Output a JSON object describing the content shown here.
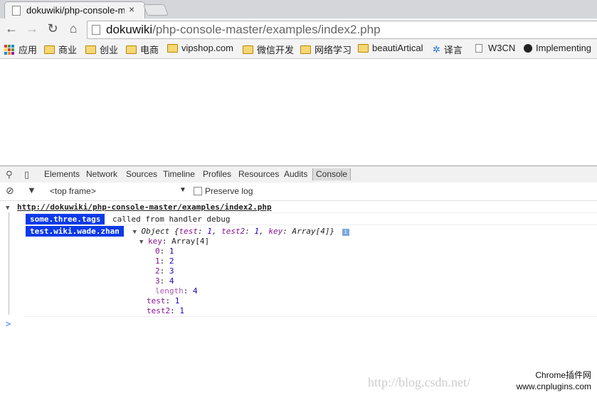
{
  "tab": {
    "title": "dokuwiki/php-console-m",
    "close": "×"
  },
  "omnibox": {
    "host": "dokuwiki",
    "path": "/php-console-master/examples/index2.php"
  },
  "nav": {
    "back": "←",
    "forward": "→",
    "reload": "↻",
    "home": "⌂"
  },
  "bookmarks": [
    {
      "label": "应用",
      "icon": "apps-icon"
    },
    {
      "label": "商业",
      "icon": "folder-icon"
    },
    {
      "label": "创业",
      "icon": "folder-icon"
    },
    {
      "label": "电商",
      "icon": "folder-icon"
    },
    {
      "label": "vipshop.com",
      "icon": "folder-icon"
    },
    {
      "label": "微信开发",
      "icon": "folder-icon"
    },
    {
      "label": "网络学习",
      "icon": "folder-icon"
    },
    {
      "label": "beautiArtical",
      "icon": "folder-icon"
    },
    {
      "label": "译言",
      "icon": "translate-icon"
    },
    {
      "label": "W3CN",
      "icon": "page-icon"
    },
    {
      "label": "Implementing",
      "icon": "site-icon"
    }
  ],
  "devtools": {
    "tabs": [
      "Elements",
      "Network",
      "Sources",
      "Timeline",
      "Profiles",
      "Resources",
      "Audits",
      "Console"
    ],
    "active_tab": "Console",
    "frame": "<top frame>",
    "preserve_log": "Preserve log"
  },
  "console": {
    "group_url": "http://dokuwiki/php-console-master/examples/index2.php",
    "row1": {
      "tag": "some.three.tags",
      "text": "called from handler debug"
    },
    "row2": {
      "tag": "test.wiki.wade.zhan",
      "obj_prefix": "Object {",
      "k1": "test",
      "v1": "1",
      "k2": "test2",
      "v2": "1",
      "k3": "key",
      "v3": "Array[4]",
      "obj_suffix": "}"
    },
    "tree": {
      "key_label": "key",
      "key_type": "Array[4]",
      "items": [
        {
          "k": "0",
          "v": "1"
        },
        {
          "k": "1",
          "v": "2"
        },
        {
          "k": "2",
          "v": "3"
        },
        {
          "k": "3",
          "v": "4"
        }
      ],
      "length_k": "length",
      "length_v": "4",
      "test_k": "test",
      "test_v": "1",
      "test2_k": "test2",
      "test2_v": "1"
    },
    "prompt": ">"
  },
  "watermark": "http://blog.csdn.net/",
  "brand": {
    "line1": "Chrome插件网",
    "line2": "www.cnplugins.com"
  },
  "colors": {
    "tag_bg": "#0b3ae8",
    "key": "#881391",
    "number": "#1c00cf",
    "prompt": "#367cf1"
  }
}
